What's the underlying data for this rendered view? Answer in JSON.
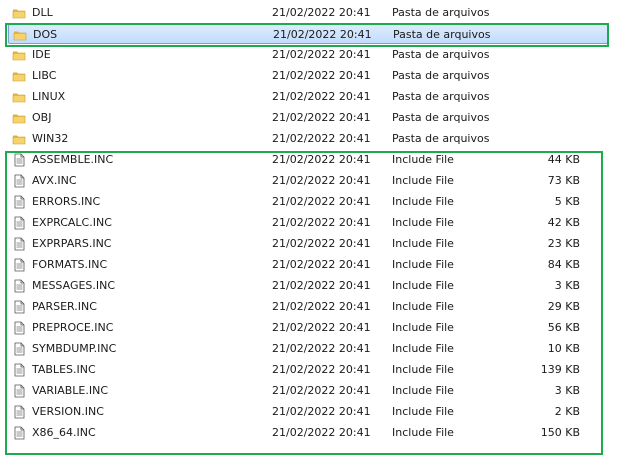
{
  "folders": [
    {
      "name": "DLL",
      "date": "21/02/2022 20:41",
      "type": "Pasta de arquivos",
      "size": "",
      "selected": false
    },
    {
      "name": "DOS",
      "date": "21/02/2022 20:41",
      "type": "Pasta de arquivos",
      "size": "",
      "selected": true
    },
    {
      "name": "IDE",
      "date": "21/02/2022 20:41",
      "type": "Pasta de arquivos",
      "size": "",
      "selected": false
    },
    {
      "name": "LIBC",
      "date": "21/02/2022 20:41",
      "type": "Pasta de arquivos",
      "size": "",
      "selected": false
    },
    {
      "name": "LINUX",
      "date": "21/02/2022 20:41",
      "type": "Pasta de arquivos",
      "size": "",
      "selected": false
    },
    {
      "name": "OBJ",
      "date": "21/02/2022 20:41",
      "type": "Pasta de arquivos",
      "size": "",
      "selected": false
    },
    {
      "name": "WIN32",
      "date": "21/02/2022 20:41",
      "type": "Pasta de arquivos",
      "size": "",
      "selected": false
    }
  ],
  "files": [
    {
      "name": "ASSEMBLE.INC",
      "date": "21/02/2022 20:41",
      "type": "Include File",
      "size": "44 KB"
    },
    {
      "name": "AVX.INC",
      "date": "21/02/2022 20:41",
      "type": "Include File",
      "size": "73 KB"
    },
    {
      "name": "ERRORS.INC",
      "date": "21/02/2022 20:41",
      "type": "Include File",
      "size": "5 KB"
    },
    {
      "name": "EXPRCALC.INC",
      "date": "21/02/2022 20:41",
      "type": "Include File",
      "size": "42 KB"
    },
    {
      "name": "EXPRPARS.INC",
      "date": "21/02/2022 20:41",
      "type": "Include File",
      "size": "23 KB"
    },
    {
      "name": "FORMATS.INC",
      "date": "21/02/2022 20:41",
      "type": "Include File",
      "size": "84 KB"
    },
    {
      "name": "MESSAGES.INC",
      "date": "21/02/2022 20:41",
      "type": "Include File",
      "size": "3 KB"
    },
    {
      "name": "PARSER.INC",
      "date": "21/02/2022 20:41",
      "type": "Include File",
      "size": "29 KB"
    },
    {
      "name": "PREPROCE.INC",
      "date": "21/02/2022 20:41",
      "type": "Include File",
      "size": "56 KB"
    },
    {
      "name": "SYMBDUMP.INC",
      "date": "21/02/2022 20:41",
      "type": "Include File",
      "size": "10 KB"
    },
    {
      "name": "TABLES.INC",
      "date": "21/02/2022 20:41",
      "type": "Include File",
      "size": "139 KB"
    },
    {
      "name": "VARIABLE.INC",
      "date": "21/02/2022 20:41",
      "type": "Include File",
      "size": "3 KB"
    },
    {
      "name": "VERSION.INC",
      "date": "21/02/2022 20:41",
      "type": "Include File",
      "size": "2 KB"
    },
    {
      "name": "X86_64.INC",
      "date": "21/02/2022 20:41",
      "type": "Include File",
      "size": "150 KB"
    }
  ],
  "colors": {
    "annotation": "#1eaa4e",
    "selection": "#cce4fc",
    "folder": "#f0c75a"
  },
  "icons": {
    "folder": "folder-icon",
    "file": "file-icon"
  }
}
